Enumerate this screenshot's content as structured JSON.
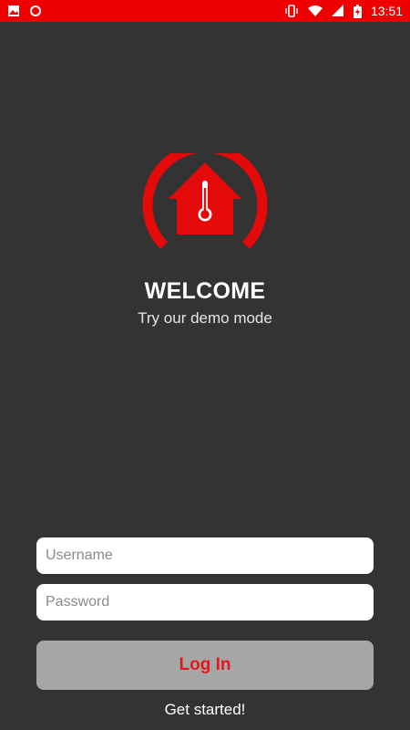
{
  "status_bar": {
    "time": "13:51",
    "icons": [
      "image-icon",
      "record-icon",
      "vibrate-icon",
      "wifi-icon",
      "signal-icon",
      "battery-charging-icon"
    ],
    "color": "#ee0000"
  },
  "logo": {
    "name": "home-thermometer-icon",
    "color": "#e40a0a"
  },
  "welcome": {
    "title": "WELCOME",
    "subtitle": "Try our demo mode"
  },
  "form": {
    "username_placeholder": "Username",
    "password_placeholder": "Password",
    "login_label": "Log In",
    "get_started_label": "Get started!"
  },
  "colors": {
    "background": "#333333",
    "accent": "#e40a0a",
    "button": "#a6a6a6"
  }
}
